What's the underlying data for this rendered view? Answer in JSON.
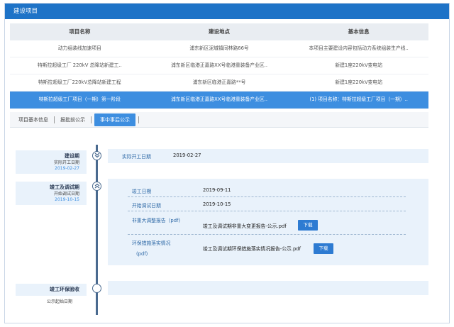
{
  "header": {
    "title": "建设项目"
  },
  "table": {
    "columns": [
      "项目名称",
      "建设地点",
      "基本信息"
    ],
    "rows": [
      [
        "动力组装线加速项目",
        "浦东新区泥城镇同林路66号",
        "本项目主要建设内容包括动力系统组装生产线.."
      ],
      [
        "特斯拉超级工厂 220kV 总降站新建工..",
        "浦东新区临港正嘉路XX号临港重装备产业区..",
        "新建1座220kV变电站"
      ],
      [
        "特斯拉超级工厂220kV总降站新建工程",
        "浦东新区临港正嘉路**号",
        "新建1座220kV变电站"
      ],
      [
        "特斯拉超级工厂项目（一期）第一阶段",
        "浦东新区临港正嘉路XX号临港重装备产业区..",
        "(1) 项目名称：特斯拉超级工厂项目（一期）.."
      ]
    ],
    "selected_row": 3
  },
  "tabs": [
    "项目基本信息",
    "报批前公示",
    "事中事后公示"
  ],
  "active_tab": 2,
  "timeline": {
    "stage1": {
      "name": "建设期",
      "sub": "实际开工日期",
      "date": "2019-02-27",
      "node_icon": "chevron-down-icon",
      "label": "实际开工日期",
      "value": "2019-02-27"
    },
    "stage2": {
      "name": "竣工及调试期",
      "sub": "开始调试日期",
      "date": "2019-10-15",
      "node_icon": "chevron-up-icon",
      "fields": [
        {
          "label": "竣工日期",
          "value": "2019-09-11"
        },
        {
          "label": "开始调试日期",
          "value": "2019-10-15"
        },
        {
          "label": "非重大调整报告（pdf)",
          "value": "竣工及调试期非重大变更报告-公示.pdf",
          "button": "下载"
        },
        {
          "label": "环保措施落实情况",
          "label2": "(pdf)",
          "value": "竣工及调试期环保措施落实情况报告-公示.pdf",
          "button": "下载"
        }
      ]
    },
    "stage3": {
      "name": "竣工环保验收",
      "sub": "公示起始日期"
    }
  }
}
